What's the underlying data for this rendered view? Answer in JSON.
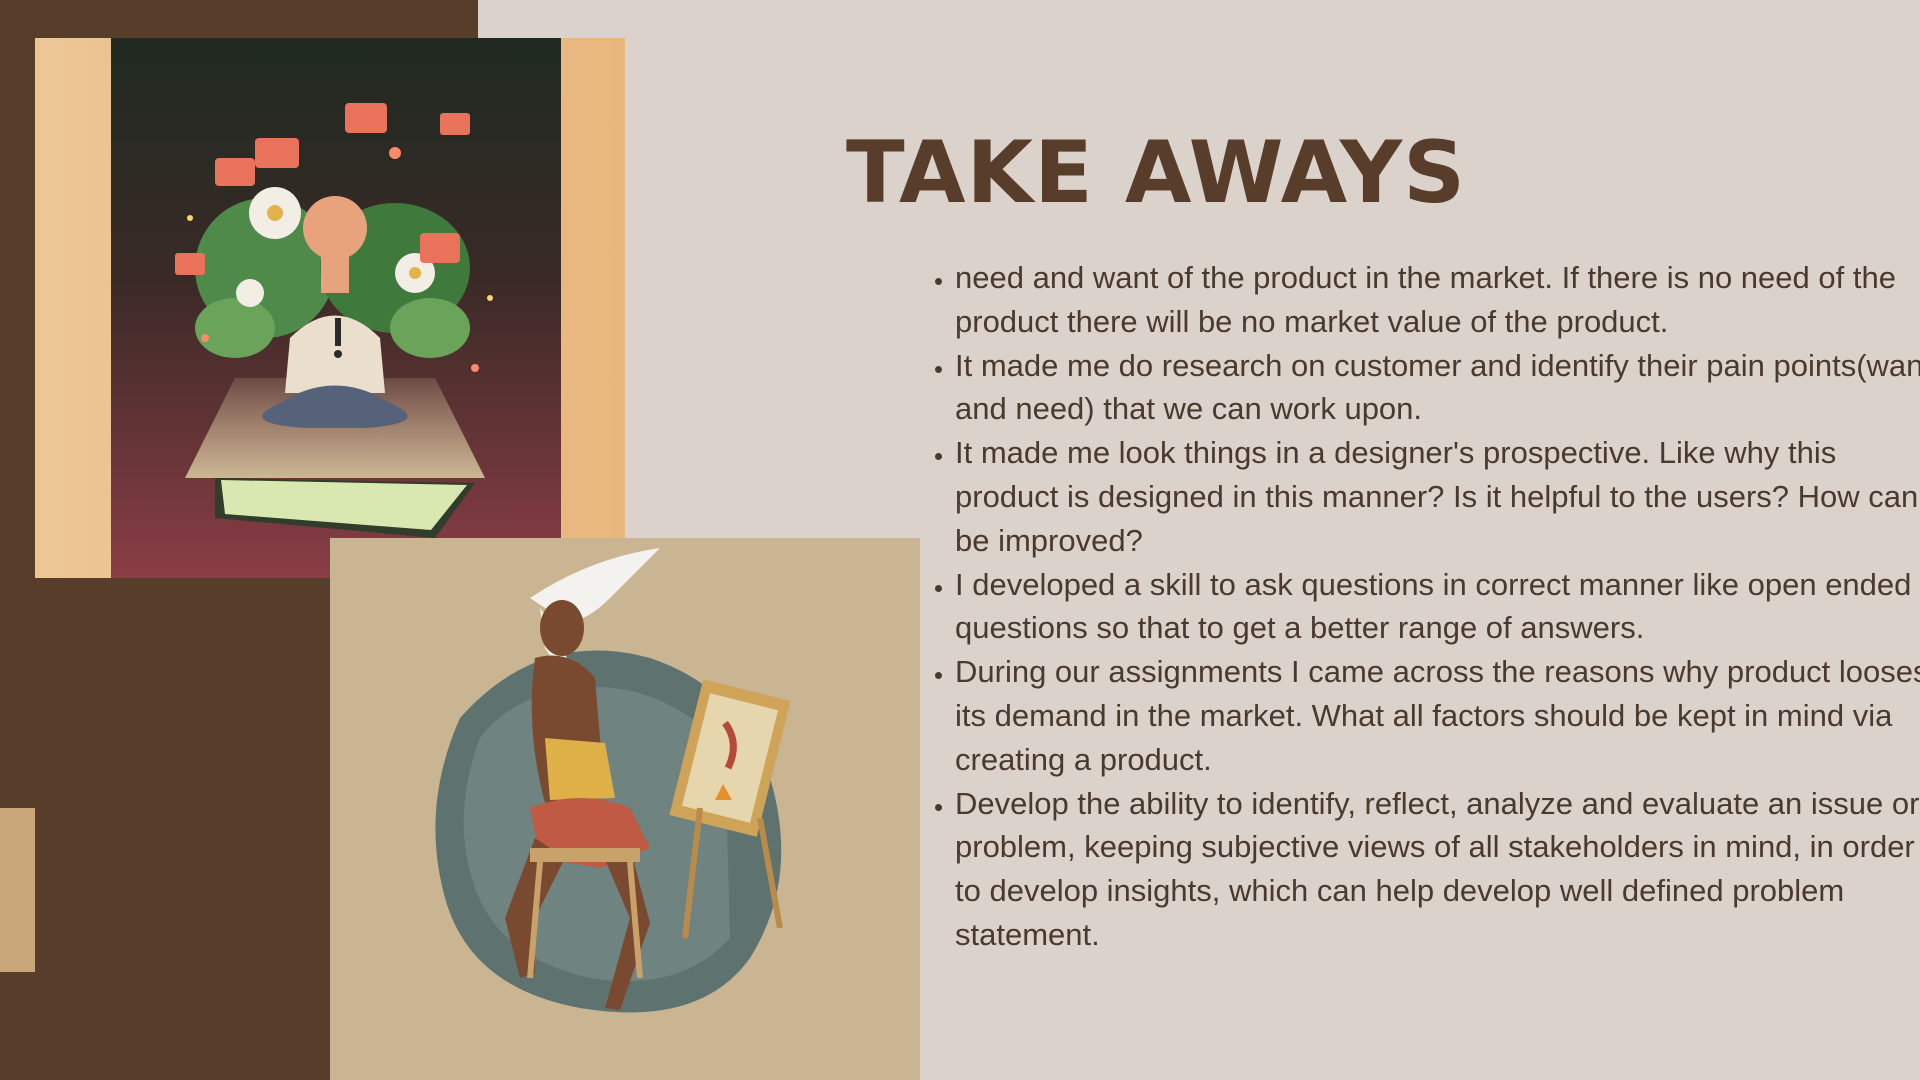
{
  "slide": {
    "title": "TAKE AWAYS",
    "bullets": [
      "need and want of the product in the market. If there is no need of the product there will be no market value of the product.",
      "It made me do research on customer and identify their pain points(want and need) that we can work upon.",
      "It made me look things in a designer's prospective. Like why this product is designed in this manner? Is it helpful to the users? How can it be improved?",
      "I developed a skill to ask questions in correct manner like open ended questions so that to get a better range of answers.",
      "During our assignments I came across the reasons why product looses its demand in the market. What all factors should be kept in mind via creating a product.",
      "Develop the ability to identify, reflect, analyze and evaluate an issue or problem, keeping subjective views of all stakeholders in mind, in order to develop insights, which can help develop well defined problem statement."
    ]
  },
  "colors": {
    "background": "#dcd2cc",
    "panel_brown": "#573d2a",
    "title": "#573d2a",
    "body_text": "#4a3a2e",
    "accent_tan": "#c9a67a"
  }
}
